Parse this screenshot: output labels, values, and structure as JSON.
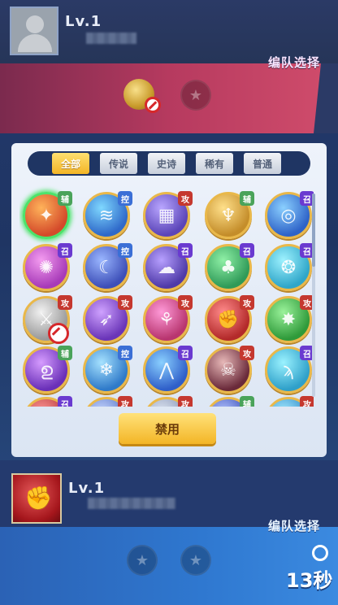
{
  "top_player": {
    "level": "Lv.1"
  },
  "top_team": {
    "label": "编队选择"
  },
  "tabs": [
    "全部",
    "传说",
    "史诗",
    "稀有",
    "普通"
  ],
  "heroes": [
    {
      "tag": "辅",
      "tag_color": "#4aa35a",
      "icon": "phoenix-icon",
      "colors": [
        "#ffb35a",
        "#d44a2a"
      ],
      "glyph": "✦",
      "selected": true
    },
    {
      "tag": "控",
      "tag_color": "#3b6fd6",
      "icon": "wave-icon",
      "colors": [
        "#7fd8ff",
        "#2f69c9"
      ],
      "glyph": "≋"
    },
    {
      "tag": "攻",
      "tag_color": "#c5382f",
      "icon": "robot-icon",
      "colors": [
        "#b9a6ff",
        "#5b45b8"
      ],
      "glyph": "▦"
    },
    {
      "tag": "辅",
      "tag_color": "#4aa35a",
      "icon": "angel-icon",
      "colors": [
        "#ffe08a",
        "#c48d2a"
      ],
      "glyph": "♆"
    },
    {
      "tag": "召",
      "tag_color": "#6a3ad0",
      "icon": "vortex-icon",
      "colors": [
        "#8bd0ff",
        "#2e63c8"
      ],
      "glyph": "◎"
    },
    {
      "tag": "召",
      "tag_color": "#6a3ad0",
      "icon": "summon-icon",
      "colors": [
        "#f49cf0",
        "#a73ab8"
      ],
      "glyph": "✺"
    },
    {
      "tag": "控",
      "tag_color": "#3b6fd6",
      "icon": "moon-icon",
      "colors": [
        "#9ab6ff",
        "#3d4fb8"
      ],
      "glyph": "☾"
    },
    {
      "tag": "召",
      "tag_color": "#6a3ad0",
      "icon": "ghost-icon",
      "colors": [
        "#b7a0ff",
        "#4f3aa8"
      ],
      "glyph": "☁"
    },
    {
      "tag": "召",
      "tag_color": "#6a3ad0",
      "icon": "tree-icon",
      "colors": [
        "#8ff0a6",
        "#2f9a58"
      ],
      "glyph": "♣"
    },
    {
      "tag": "召",
      "tag_color": "#6a3ad0",
      "icon": "spirit-icon",
      "colors": [
        "#9ef2ff",
        "#2fa6c9"
      ],
      "glyph": "❂"
    },
    {
      "tag": "攻",
      "tag_color": "#c5382f",
      "icon": "knight-icon",
      "colors": [
        "#f2f2f2",
        "#9a9a9a"
      ],
      "glyph": "⚔",
      "banned": true
    },
    {
      "tag": "攻",
      "tag_color": "#c5382f",
      "icon": "bow-icon",
      "colors": [
        "#cfa2ff",
        "#6a35b8"
      ],
      "glyph": "➶"
    },
    {
      "tag": "攻",
      "tag_color": "#c5382f",
      "icon": "dagger-icon",
      "colors": [
        "#ff9ad8",
        "#b8356f"
      ],
      "glyph": "⚘"
    },
    {
      "tag": "攻",
      "tag_color": "#c5382f",
      "icon": "fist-icon",
      "colors": [
        "#ff8a8a",
        "#b32a2a"
      ],
      "glyph": "✊"
    },
    {
      "tag": "攻",
      "tag_color": "#c5382f",
      "icon": "star-icon",
      "colors": [
        "#9af29a",
        "#2f9a3a"
      ],
      "glyph": "✸"
    },
    {
      "tag": "辅",
      "tag_color": "#4aa35a",
      "icon": "dragon-icon",
      "colors": [
        "#d69cff",
        "#6a30b8"
      ],
      "glyph": "ഉ"
    },
    {
      "tag": "控",
      "tag_color": "#3b6fd6",
      "icon": "snowflake-icon",
      "colors": [
        "#a6e2ff",
        "#2f7ac9"
      ],
      "glyph": "❄"
    },
    {
      "tag": "召",
      "tag_color": "#6a3ad0",
      "icon": "ice-icon",
      "colors": [
        "#8ad0ff",
        "#2f5fc9"
      ],
      "glyph": "⋀"
    },
    {
      "tag": "攻",
      "tag_color": "#c5382f",
      "icon": "skull-icon",
      "colors": [
        "#e7b8b8",
        "#6a2a3a"
      ],
      "glyph": "☠"
    },
    {
      "tag": "召",
      "tag_color": "#6a3ad0",
      "icon": "tornado-icon",
      "colors": [
        "#9af2ff",
        "#2fa0c9"
      ],
      "glyph": "ϡ"
    },
    {
      "tag": "召",
      "tag_color": "#6a3ad0",
      "icon": "hero-icon",
      "colors": [
        "#ff9a9a",
        "#b83a3a"
      ],
      "glyph": "●"
    },
    {
      "tag": "攻",
      "tag_color": "#c5382f",
      "icon": "hero-icon",
      "colors": [
        "#c9d8ff",
        "#5a78c9"
      ],
      "glyph": "●"
    },
    {
      "tag": "攻",
      "tag_color": "#c5382f",
      "icon": "hero-icon",
      "colors": [
        "#dfe6f2",
        "#8a98b8"
      ],
      "glyph": "●"
    },
    {
      "tag": "辅",
      "tag_color": "#4aa35a",
      "icon": "hero-icon",
      "colors": [
        "#b6c6ff",
        "#3a4fb8"
      ],
      "glyph": "●"
    },
    {
      "tag": "攻",
      "tag_color": "#c5382f",
      "icon": "hero-icon",
      "colors": [
        "#a6ecff",
        "#2f8ac9"
      ],
      "glyph": "●"
    }
  ],
  "ban_button": "禁用",
  "bottom_player": {
    "level": "Lv.1"
  },
  "bottom_team": {
    "label": "编队选择"
  },
  "timer": {
    "text": "13秒"
  }
}
